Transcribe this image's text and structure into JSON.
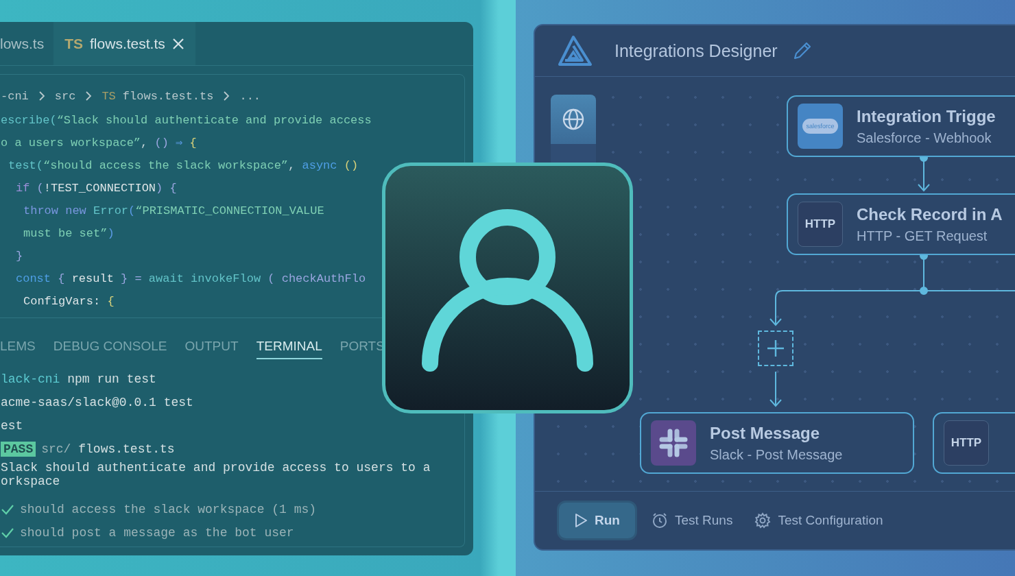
{
  "editor": {
    "tabs": [
      {
        "label": "lows.ts",
        "selected": false,
        "closable": false
      },
      {
        "badge": "TS",
        "label": "flows.test.ts",
        "selected": true,
        "closable": true
      }
    ],
    "breadcrumb": [
      {
        "text": "-cni"
      },
      {
        "text": "src"
      },
      {
        "badge": "TS",
        "text": "flows.test.ts"
      },
      {
        "text": "..."
      }
    ],
    "code_lines": [
      {
        "tokens": [
          {
            "t": "escribe(",
            "kind": "fn"
          },
          {
            "t": "“Slack should authenticate and provide access",
            "kind": "string"
          }
        ]
      },
      {
        "tokens": [
          {
            "t": "o a users workspace”",
            "kind": "string"
          },
          {
            "t": ", ",
            "kind": "plain"
          },
          {
            "t": "()",
            "kind": "paren"
          },
          {
            "t": " ⇒ ",
            "kind": "op"
          },
          {
            "t": "{",
            "kind": "brace"
          }
        ],
        "children": [
          {
            "tokens": [
              {
                "t": "test(",
                "kind": "fn"
              },
              {
                "t": "“should access the slack workspace”",
                "kind": "string"
              },
              {
                "t": ", ",
                "kind": "plain"
              },
              {
                "t": "async",
                "kind": "keyword"
              },
              {
                "t": " ()",
                "kind": "brace"
              }
            ],
            "children": [
              {
                "tokens": [
                  {
                    "t": "if",
                    "kind": "control"
                  },
                  {
                    "t": " (",
                    "kind": "paren"
                  },
                  {
                    "t": "!TEST_CONNECTION",
                    "kind": "ident"
                  },
                  {
                    "t": ") {",
                    "kind": "paren"
                  }
                ],
                "children": [
                  {
                    "tokens": [
                      {
                        "t": "throw new",
                        "kind": "keyword2"
                      },
                      {
                        "t": " Error",
                        "kind": "fn"
                      },
                      {
                        "t": "(",
                        "kind": "op"
                      },
                      {
                        "t": "“PRISMATIC_CONNECTION_VALUE",
                        "kind": "string"
                      }
                    ]
                  },
                  {
                    "tokens": [
                      {
                        "t": "must be set”",
                        "kind": "string"
                      },
                      {
                        "t": ")",
                        "kind": "op"
                      }
                    ]
                  }
                ]
              },
              {
                "tokens": [
                  {
                    "t": "}",
                    "kind": "paren"
                  }
                ]
              },
              {
                "tokens": [
                  {
                    "t": "const",
                    "kind": "keyword"
                  },
                  {
                    "t": " { ",
                    "kind": "paren"
                  },
                  {
                    "t": "result",
                    "kind": "ident"
                  },
                  {
                    "t": " } = ",
                    "kind": "paren"
                  },
                  {
                    "t": "await invokeFlow",
                    "kind": "fn"
                  },
                  {
                    "t": " ( ",
                    "kind": "paren"
                  },
                  {
                    "t": "checkAuthFlo",
                    "kind": "paren"
                  }
                ],
                "children": [
                  {
                    "tokens": [
                      {
                        "t": "ConfigVars:",
                        "kind": "ident"
                      },
                      {
                        "t": " {",
                        "kind": "brace"
                      }
                    ]
                  }
                ]
              }
            ]
          }
        ]
      }
    ]
  },
  "panel": {
    "tabs": [
      {
        "label": "LEMS",
        "selected": false
      },
      {
        "label": "DEBUG CONSOLE",
        "selected": false
      },
      {
        "label": "OUTPUT",
        "selected": false
      },
      {
        "label": "TERMINAL",
        "selected": true
      },
      {
        "label": "PORTS",
        "selected": false
      }
    ],
    "terminal": [
      {
        "kind": "prompt",
        "prefix": "lack-cni",
        "text": "npm run test"
      },
      {
        "kind": "plain",
        "text": "acme-saas/slack@0.0.1 test"
      },
      {
        "kind": "plain",
        "text": "est"
      },
      {
        "kind": "result",
        "badge": "PASS",
        "dir": "src/",
        "text": "flows.test.ts"
      },
      {
        "kind": "wrap",
        "text": "Slack should authenticate and provide access to users to a"
      },
      {
        "kind": "wrap",
        "text": "orkspace"
      },
      {
        "kind": "check",
        "text": "should access the slack workspace (1 ms)"
      },
      {
        "kind": "check",
        "text": "should post a message as the bot user"
      }
    ]
  },
  "designer": {
    "title": "Integrations Designer",
    "sidebar": [
      {
        "kind": "globe",
        "selected": true
      }
    ],
    "nodes": [
      {
        "kind": "salesforce",
        "icon_text": "salesforce",
        "title": "Integration Trigge",
        "subtitle": "Salesforce - Webhook"
      },
      {
        "kind": "http",
        "icon_text": "HTTP",
        "title": "Check Record in A",
        "subtitle": "HTTP - GET Request"
      },
      {
        "kind": "slack",
        "title": "Post Message",
        "subtitle": "Slack - Post Message"
      },
      {
        "kind": "http",
        "icon_text": "HTTP"
      }
    ],
    "footer": [
      {
        "kind": "run",
        "label": "Run"
      },
      {
        "kind": "timer",
        "label": "Test Runs"
      },
      {
        "kind": "settings",
        "label": "Test Configuration"
      }
    ]
  }
}
